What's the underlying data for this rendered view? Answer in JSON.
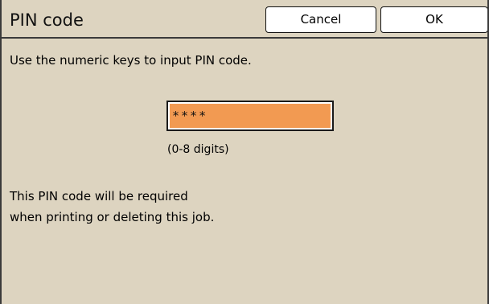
{
  "dialog": {
    "title": "PIN code",
    "cancel_label": "Cancel",
    "ok_label": "OK"
  },
  "main": {
    "instruction": "Use the numeric keys to input PIN code.",
    "pin_value": "****",
    "pin_hint": "(0-8 digits)",
    "note_line1": "This PIN code will be required",
    "note_line2": "when printing or deleting this job."
  },
  "colors": {
    "background": "#ddd4c0",
    "pin_field": "#f29a52",
    "button": "#ffffff"
  }
}
